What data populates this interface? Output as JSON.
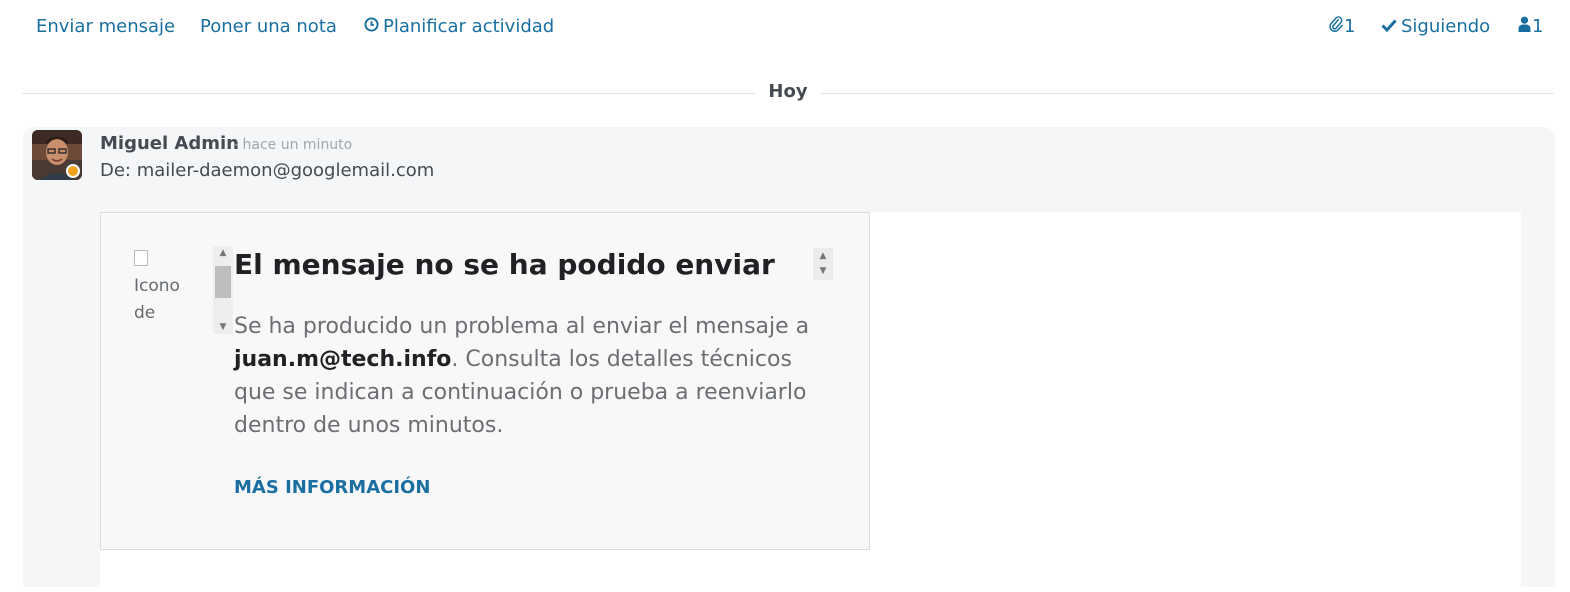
{
  "toolbar": {
    "send_message": "Enviar mensaje",
    "log_note": "Poner una nota",
    "schedule_activity": "Planificar actividad",
    "schedule_icon": "clock-icon",
    "attachments_count": "1",
    "attachments_icon": "paperclip-icon",
    "following": "Siguiendo",
    "following_icon": "check-icon",
    "followers_count": "1",
    "followers_icon": "user-icon"
  },
  "separator": {
    "label": "Hoy"
  },
  "message": {
    "author": "Miguel Admin",
    "time": "- hace un minuto",
    "from": "De: mailer-daemon@googlemail.com",
    "presence_color": "#f0a21c"
  },
  "bounce": {
    "broken_image_alt": "Icono de",
    "title": "El mensaje no se ha podido enviar",
    "text_before": "Se ha producido un problema al enviar el mensaje a ",
    "recipient": "juan.m@tech.info",
    "text_after": ". Consulta los detalles técnicos que se indican a continuación o prueba a reenviarlo dentro de unos minutos.",
    "more_info": "MÁS INFORMACIÓN"
  },
  "colors": {
    "link": "#1a6fa0",
    "message_bg": "#f5f6f8"
  }
}
